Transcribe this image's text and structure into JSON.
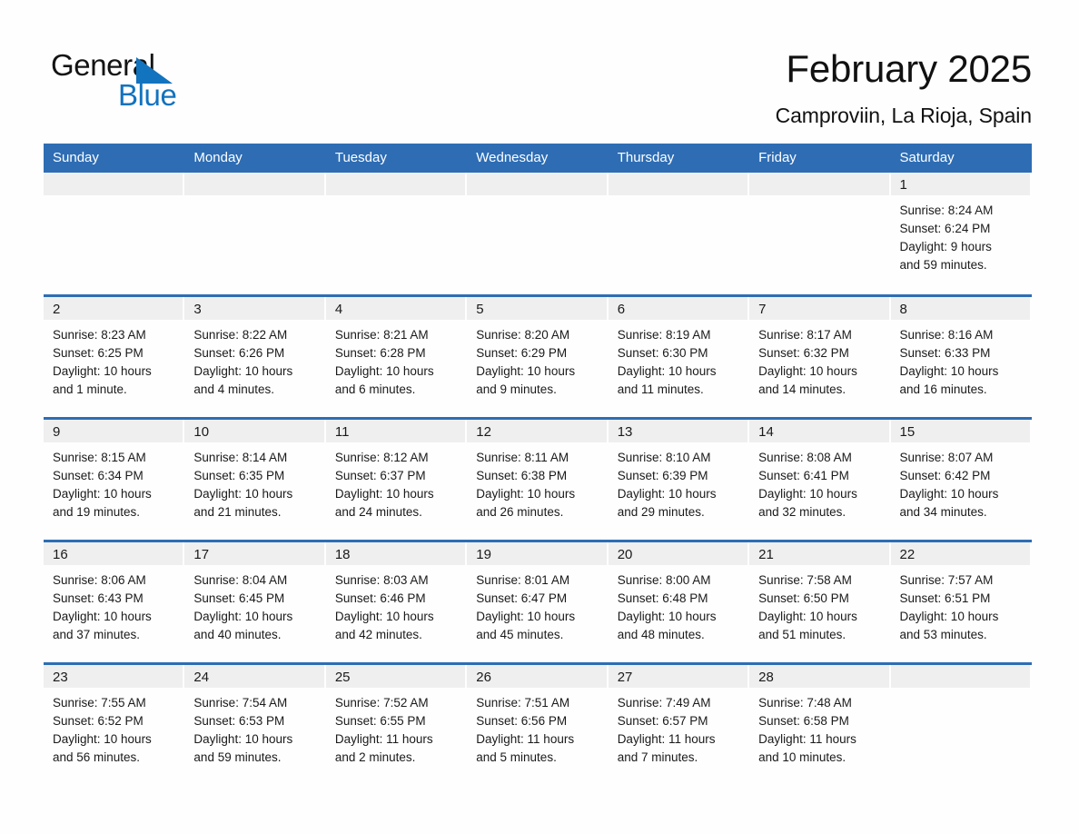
{
  "brand": {
    "name_part1": "General",
    "name_part2": "Blue",
    "accent_color": "#1273BE"
  },
  "header": {
    "month_title": "February 2025",
    "location": "Camproviin, La Rioja, Spain"
  },
  "theme": {
    "header_blue": "#2E6DB4",
    "date_band_gray": "#EFEFEF",
    "cell_white": "#FEFEFE"
  },
  "calendar": {
    "weekday_headers": [
      "Sunday",
      "Monday",
      "Tuesday",
      "Wednesday",
      "Thursday",
      "Friday",
      "Saturday"
    ],
    "weeks": [
      [
        {
          "day": "",
          "lines": []
        },
        {
          "day": "",
          "lines": []
        },
        {
          "day": "",
          "lines": []
        },
        {
          "day": "",
          "lines": []
        },
        {
          "day": "",
          "lines": []
        },
        {
          "day": "",
          "lines": []
        },
        {
          "day": "1",
          "lines": [
            "Sunrise: 8:24 AM",
            "Sunset: 6:24 PM",
            "Daylight: 9 hours",
            "and 59 minutes."
          ]
        }
      ],
      [
        {
          "day": "2",
          "lines": [
            "Sunrise: 8:23 AM",
            "Sunset: 6:25 PM",
            "Daylight: 10 hours",
            "and 1 minute."
          ]
        },
        {
          "day": "3",
          "lines": [
            "Sunrise: 8:22 AM",
            "Sunset: 6:26 PM",
            "Daylight: 10 hours",
            "and 4 minutes."
          ]
        },
        {
          "day": "4",
          "lines": [
            "Sunrise: 8:21 AM",
            "Sunset: 6:28 PM",
            "Daylight: 10 hours",
            "and 6 minutes."
          ]
        },
        {
          "day": "5",
          "lines": [
            "Sunrise: 8:20 AM",
            "Sunset: 6:29 PM",
            "Daylight: 10 hours",
            "and 9 minutes."
          ]
        },
        {
          "day": "6",
          "lines": [
            "Sunrise: 8:19 AM",
            "Sunset: 6:30 PM",
            "Daylight: 10 hours",
            "and 11 minutes."
          ]
        },
        {
          "day": "7",
          "lines": [
            "Sunrise: 8:17 AM",
            "Sunset: 6:32 PM",
            "Daylight: 10 hours",
            "and 14 minutes."
          ]
        },
        {
          "day": "8",
          "lines": [
            "Sunrise: 8:16 AM",
            "Sunset: 6:33 PM",
            "Daylight: 10 hours",
            "and 16 minutes."
          ]
        }
      ],
      [
        {
          "day": "9",
          "lines": [
            "Sunrise: 8:15 AM",
            "Sunset: 6:34 PM",
            "Daylight: 10 hours",
            "and 19 minutes."
          ]
        },
        {
          "day": "10",
          "lines": [
            "Sunrise: 8:14 AM",
            "Sunset: 6:35 PM",
            "Daylight: 10 hours",
            "and 21 minutes."
          ]
        },
        {
          "day": "11",
          "lines": [
            "Sunrise: 8:12 AM",
            "Sunset: 6:37 PM",
            "Daylight: 10 hours",
            "and 24 minutes."
          ]
        },
        {
          "day": "12",
          "lines": [
            "Sunrise: 8:11 AM",
            "Sunset: 6:38 PM",
            "Daylight: 10 hours",
            "and 26 minutes."
          ]
        },
        {
          "day": "13",
          "lines": [
            "Sunrise: 8:10 AM",
            "Sunset: 6:39 PM",
            "Daylight: 10 hours",
            "and 29 minutes."
          ]
        },
        {
          "day": "14",
          "lines": [
            "Sunrise: 8:08 AM",
            "Sunset: 6:41 PM",
            "Daylight: 10 hours",
            "and 32 minutes."
          ]
        },
        {
          "day": "15",
          "lines": [
            "Sunrise: 8:07 AM",
            "Sunset: 6:42 PM",
            "Daylight: 10 hours",
            "and 34 minutes."
          ]
        }
      ],
      [
        {
          "day": "16",
          "lines": [
            "Sunrise: 8:06 AM",
            "Sunset: 6:43 PM",
            "Daylight: 10 hours",
            "and 37 minutes."
          ]
        },
        {
          "day": "17",
          "lines": [
            "Sunrise: 8:04 AM",
            "Sunset: 6:45 PM",
            "Daylight: 10 hours",
            "and 40 minutes."
          ]
        },
        {
          "day": "18",
          "lines": [
            "Sunrise: 8:03 AM",
            "Sunset: 6:46 PM",
            "Daylight: 10 hours",
            "and 42 minutes."
          ]
        },
        {
          "day": "19",
          "lines": [
            "Sunrise: 8:01 AM",
            "Sunset: 6:47 PM",
            "Daylight: 10 hours",
            "and 45 minutes."
          ]
        },
        {
          "day": "20",
          "lines": [
            "Sunrise: 8:00 AM",
            "Sunset: 6:48 PM",
            "Daylight: 10 hours",
            "and 48 minutes."
          ]
        },
        {
          "day": "21",
          "lines": [
            "Sunrise: 7:58 AM",
            "Sunset: 6:50 PM",
            "Daylight: 10 hours",
            "and 51 minutes."
          ]
        },
        {
          "day": "22",
          "lines": [
            "Sunrise: 7:57 AM",
            "Sunset: 6:51 PM",
            "Daylight: 10 hours",
            "and 53 minutes."
          ]
        }
      ],
      [
        {
          "day": "23",
          "lines": [
            "Sunrise: 7:55 AM",
            "Sunset: 6:52 PM",
            "Daylight: 10 hours",
            "and 56 minutes."
          ]
        },
        {
          "day": "24",
          "lines": [
            "Sunrise: 7:54 AM",
            "Sunset: 6:53 PM",
            "Daylight: 10 hours",
            "and 59 minutes."
          ]
        },
        {
          "day": "25",
          "lines": [
            "Sunrise: 7:52 AM",
            "Sunset: 6:55 PM",
            "Daylight: 11 hours",
            "and 2 minutes."
          ]
        },
        {
          "day": "26",
          "lines": [
            "Sunrise: 7:51 AM",
            "Sunset: 6:56 PM",
            "Daylight: 11 hours",
            "and 5 minutes."
          ]
        },
        {
          "day": "27",
          "lines": [
            "Sunrise: 7:49 AM",
            "Sunset: 6:57 PM",
            "Daylight: 11 hours",
            "and 7 minutes."
          ]
        },
        {
          "day": "28",
          "lines": [
            "Sunrise: 7:48 AM",
            "Sunset: 6:58 PM",
            "Daylight: 11 hours",
            "and 10 minutes."
          ]
        },
        {
          "day": "",
          "lines": []
        }
      ]
    ]
  }
}
